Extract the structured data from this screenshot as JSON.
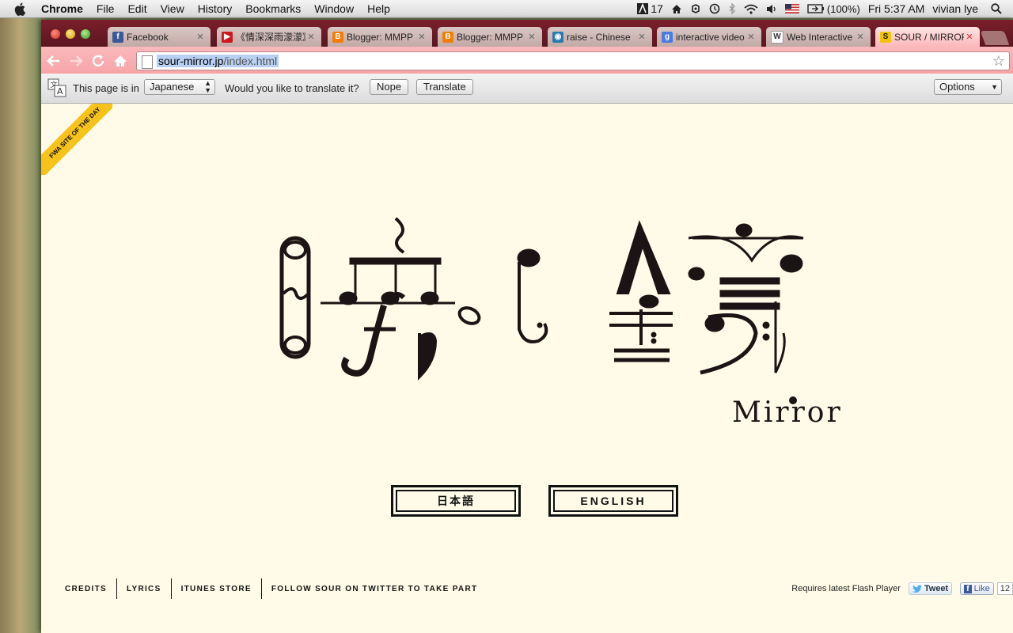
{
  "menubar": {
    "app": "Chrome",
    "items": [
      "File",
      "Edit",
      "View",
      "History",
      "Bookmarks",
      "Window",
      "Help"
    ],
    "status": {
      "adobe_count": "17",
      "battery": "(100%)",
      "clock": "Fri 5:37 AM",
      "user": "vivian lye"
    }
  },
  "tabs": [
    {
      "title": "Facebook",
      "icon": "facebook-icon",
      "color": "#3b5998"
    },
    {
      "title": "《情深深雨濛濛》",
      "icon": "youtube-icon",
      "color": "#cc181e"
    },
    {
      "title": "Blogger: MMPP",
      "icon": "blogger-icon",
      "color": "#f57d00"
    },
    {
      "title": "Blogger: MMPP",
      "icon": "blogger-icon",
      "color": "#f57d00"
    },
    {
      "title": "raise - Chinese",
      "icon": "speech-bubble-icon",
      "color": "#2a7ab0"
    },
    {
      "title": "interactive video",
      "icon": "google-icon",
      "color": "#4a7be0"
    },
    {
      "title": "Web Interactive",
      "icon": "wikipedia-icon",
      "color": "#888888"
    },
    {
      "title": "SOUR / MIRROR",
      "icon": "sour-icon",
      "color": "#f2c400",
      "active": true
    }
  ],
  "address": {
    "host": "sour-mirror.jp",
    "path": "/index.html"
  },
  "translate": {
    "prefix": "This page is in",
    "language": "Japanese",
    "question": "Would you like to translate it?",
    "nope": "Nope",
    "translate": "Translate",
    "options": "Options"
  },
  "page": {
    "ribbon": "FWA SITE OF THE DAY",
    "logo_sub": "Mirror",
    "btn_ja": "日本語",
    "btn_en": "ENGLISH",
    "footer_links": [
      "CREDITS",
      "LYRICS",
      "ITUNES STORE",
      "FOLLOW SOUR ON TWITTER TO TAKE PART"
    ],
    "flash_note": "Requires latest Flash Player",
    "tweet": "Tweet",
    "like": "Like",
    "like_count": "12"
  }
}
